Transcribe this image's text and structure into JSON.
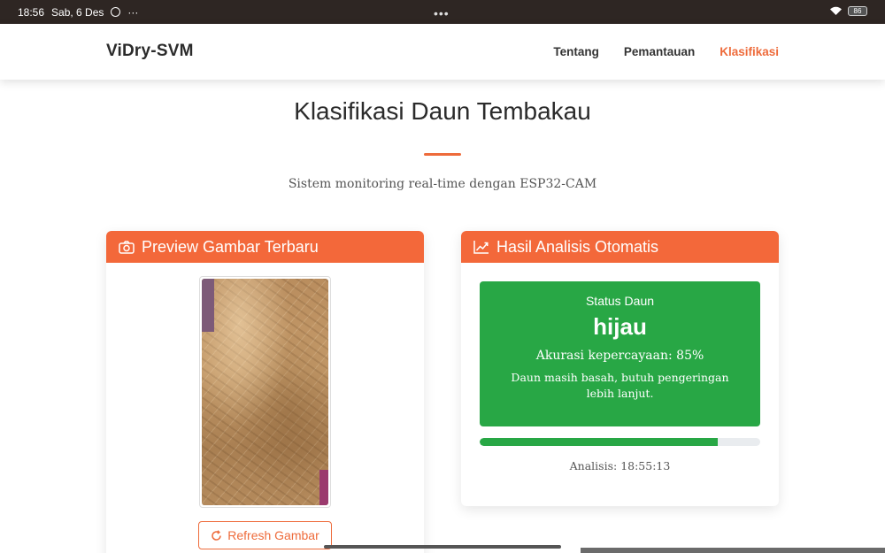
{
  "statusbar": {
    "time": "18:56",
    "date": "Sab, 6 Des",
    "more": "···",
    "dots": "•••",
    "battery": "86"
  },
  "nav": {
    "brand": "ViDry-SVM",
    "links": [
      "Tentang",
      "Pemantauan",
      "Klasifikasi"
    ],
    "active": "Klasifikasi"
  },
  "header": {
    "title": "Klasifikasi Daun Tembakau",
    "subtitle": "Sistem monitoring real-time dengan ESP32-CAM"
  },
  "preview": {
    "title": "Preview Gambar Terbaru",
    "refresh_label": "Refresh Gambar"
  },
  "analysis": {
    "title": "Hasil Analisis Otomatis",
    "status_label": "Status Daun",
    "status_value": "hijau",
    "accuracy_text": "Akurasi kepercayaan: 85%",
    "accuracy_percent": 85,
    "description": "Daun masih basah, butuh pengeringan lebih lanjut.",
    "time_text": "Analisis: 18:55:13"
  },
  "colors": {
    "accent": "#f3683a",
    "status_green": "#28a745"
  },
  "icons": {
    "preview": "camera-icon",
    "analysis": "chart-line-icon",
    "refresh": "refresh-icon"
  }
}
